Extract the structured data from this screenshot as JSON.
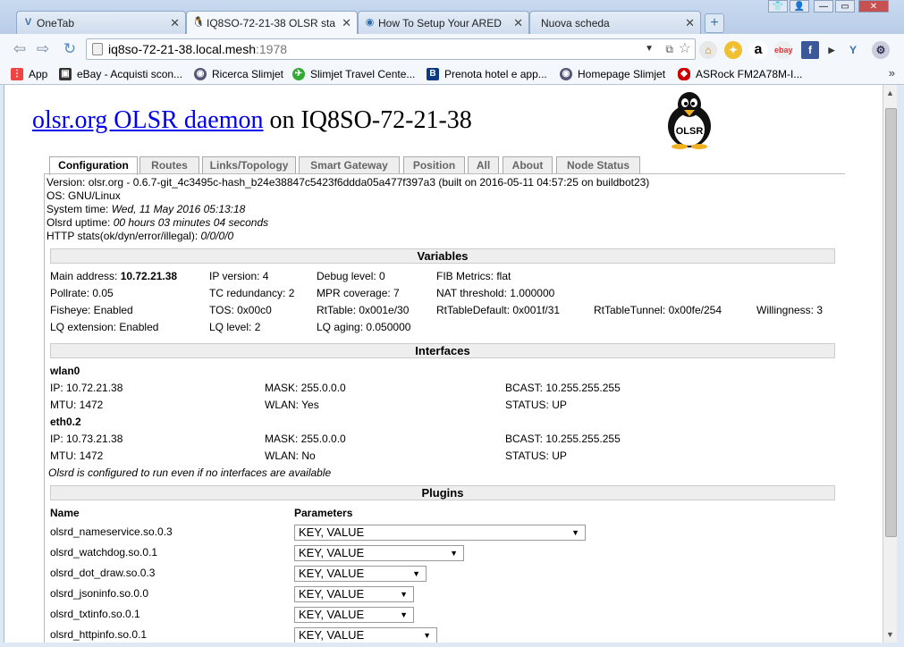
{
  "browser": {
    "tabs": [
      {
        "label": "OneTab",
        "icon": "onetab-icon"
      },
      {
        "label": "IQ8SO-72-21-38 OLSR sta",
        "icon": "olsr-penguin-icon"
      },
      {
        "label": "How To Setup Your ARED",
        "icon": "globe-icon"
      },
      {
        "label": "Nuova scheda",
        "icon": ""
      }
    ],
    "close_glyph": "✕",
    "new_tab_glyph": "+",
    "window_controls": [
      "—",
      "▭",
      "✕"
    ],
    "url_host": "iq8so-72-21-38.local.mesh",
    "url_port": ":1978",
    "bookmarks": [
      {
        "label": "App",
        "icon": "apps-grid-icon",
        "color": "#e44"
      },
      {
        "label": "eBay - Acquisti scon...",
        "icon": "shopping-bag-icon",
        "color": "#333"
      },
      {
        "label": "Ricerca Slimjet",
        "icon": "globe-icon",
        "color": "#557"
      },
      {
        "label": "Slimjet Travel Cente...",
        "icon": "plane-icon",
        "color": "#3a3"
      },
      {
        "label": "Prenota hotel e app...",
        "icon": "booking-b-icon",
        "color": "#0b3a80"
      },
      {
        "label": "Homepage Slimjet",
        "icon": "globe-icon",
        "color": "#557"
      },
      {
        "label": "ASRock FM2A78M-I...",
        "icon": "asrock-icon",
        "color": "#c00"
      }
    ],
    "bookmarks_more": "»"
  },
  "page": {
    "title_link": "olsr.org OLSR daemon",
    "title_rest": " on IQ8SO-72-21-38",
    "logo_text": "OLSR",
    "tabs": [
      "Configuration",
      "Routes",
      "Links/Topology",
      "Smart Gateway",
      "Position",
      "All",
      "About",
      "Node Status"
    ],
    "info": {
      "version": "Version: olsr.org - 0.6.7-git_4c3495c-hash_b24e38847c5423f6ddda05a477f397a3 (built on 2016-05-11 04:57:25 on buildbot23)",
      "os": "OS: GNU/Linux",
      "system_time_label": "System time: ",
      "system_time": "Wed, 11 May 2016 05:13:18",
      "uptime_label": "Olsrd uptime: ",
      "uptime": "00 hours 03 minutes 04 seconds",
      "http_label": "HTTP stats(ok/dyn/error/illegal): ",
      "http": "0/0/0/0"
    },
    "variables_title": "Variables",
    "variables": {
      "main_address_label": "Main address: ",
      "main_address": "10.72.21.38",
      "ip_version": "IP version: 4",
      "debug_level": "Debug level: 0",
      "fib_metrics": "FIB Metrics: flat",
      "pollrate": "Pollrate: 0.05",
      "tc_redundancy": "TC redundancy: 2",
      "mpr_coverage": "MPR coverage: 7",
      "nat_threshold": "NAT threshold: 1.000000",
      "fisheye": "Fisheye: Enabled",
      "tos": "TOS: 0x00c0",
      "rttable": "RtTable: 0x001e/30",
      "rttable_default": "RtTableDefault: 0x001f/31",
      "rttable_tunnel": "RtTableTunnel: 0x00fe/254",
      "willingness": "Willingness: 3",
      "lq_extension": "LQ extension: Enabled",
      "lq_level": "LQ level: 2",
      "lq_aging": "LQ aging: 0.050000"
    },
    "interfaces_title": "Interfaces",
    "interfaces": [
      {
        "name": "wlan0",
        "ip": "IP: 10.72.21.38",
        "mask": "MASK: 255.0.0.0",
        "bcast": "BCAST: 10.255.255.255",
        "mtu": "MTU: 1472",
        "wlan": "WLAN: Yes",
        "status": "STATUS: UP"
      },
      {
        "name": "eth0.2",
        "ip": "IP: 10.73.21.38",
        "mask": "MASK: 255.0.0.0",
        "bcast": "BCAST: 10.255.255.255",
        "mtu": "MTU: 1472",
        "wlan": "WLAN: No",
        "status": "STATUS: UP"
      }
    ],
    "interfaces_note": "Olsrd is configured to run even if no interfaces are available",
    "plugins_title": "Plugins",
    "plugins_header_name": "Name",
    "plugins_header_params": "Parameters",
    "plugins": [
      {
        "name": "olsrd_nameservice.so.0.3",
        "param": "KEY, VALUE"
      },
      {
        "name": "olsrd_watchdog.so.0.1",
        "param": "KEY, VALUE"
      },
      {
        "name": "olsrd_dot_draw.so.0.3",
        "param": "KEY, VALUE"
      },
      {
        "name": "olsrd_jsoninfo.so.0.0",
        "param": "KEY, VALUE"
      },
      {
        "name": "olsrd_txtinfo.so.0.1",
        "param": "KEY, VALUE"
      },
      {
        "name": "olsrd_httpinfo.so.0.1",
        "param": "KEY, VALUE"
      }
    ]
  }
}
